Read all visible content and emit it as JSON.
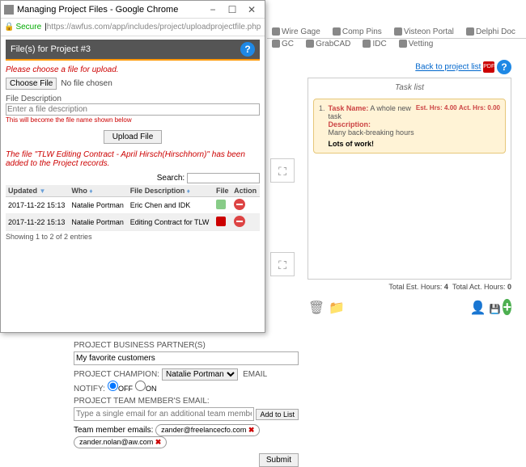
{
  "popup": {
    "window_title": "Managing Project Files - Google Chrome",
    "secure_label": "Secure",
    "url": "https://awfus.com/app/includes/project/uploadprojectfile.php",
    "panel_title": "File(s) for Project #3",
    "choose_prompt": "Please choose a file for upload.",
    "choose_btn": "Choose File",
    "no_file": "No file chosen",
    "fdesc_label": "File Description",
    "fdesc_placeholder": "Enter a file description",
    "fdesc_warn": "This will become the file name shown below",
    "upload_btn": "Upload File",
    "added_msg": "The file \"TLW Editing Contract - April Hirsch(Hirschhorn)\" has been added to the Project records.",
    "search_label": "Search:",
    "table": {
      "headers": {
        "updated": "Updated",
        "who": "Who",
        "desc": "File Description",
        "file": "File",
        "action": "Action"
      },
      "rows": [
        {
          "updated": "2017-11-22 15:13",
          "who": "Natalie Portman",
          "desc": "Eric Chen and IDK"
        },
        {
          "updated": "2017-11-22 15:13",
          "who": "Natalie Portman",
          "desc": "Editing Contract for TLW"
        }
      ],
      "footer": "Showing 1 to 2 of 2 entries"
    }
  },
  "bg_tabs": [
    "Wire Gage",
    "Comp Pins",
    "Visteon Portal",
    "Delphi Doc",
    "GC",
    "GrabCAD",
    "IDC",
    "Vetting"
  ],
  "task_panel": {
    "back_link": "Back to project list",
    "title": "Task list",
    "task": {
      "num": "1.",
      "name_label": "Task Name:",
      "name": "A whole new task",
      "desc_label": "Description:",
      "desc": "Many back-breaking hours",
      "note": "Lots of work!",
      "est_label": "Est. Hrs:",
      "est": "4.00",
      "act_label": "Act. Hrs:",
      "act": "0.00"
    },
    "totals": {
      "est_label": "Total Est. Hours:",
      "est": "4",
      "act_label": "Total Act. Hours:",
      "act": "0"
    }
  },
  "form": {
    "partner_label": "PROJECT BUSINESS PARTNER(S)",
    "partner_value": "My favorite customers",
    "champion_label": "PROJECT CHAMPION:",
    "champion_value": "Natalie Portman",
    "notify_label": "EMAIL NOTIFY:",
    "off_label": "OFF",
    "on_label": "ON",
    "team_label": "PROJECT TEAM MEMBER'S EMAIL:",
    "team_placeholder": "Type a single email for an additional team member",
    "add_btn": "Add to List",
    "chips_label": "Team member emails:",
    "chips": [
      "zander@freelancecfo.com",
      "zander.nolan@aw.com"
    ],
    "submit": "Submit"
  }
}
